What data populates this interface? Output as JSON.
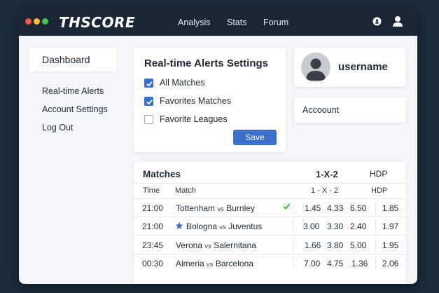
{
  "app": {
    "brand": "THSCORE"
  },
  "nav": {
    "analysis": "Analysis",
    "stats": "Stats",
    "forum": "Forum"
  },
  "topbar_icons": [
    "info-icon",
    "user-icon"
  ],
  "sidebar": {
    "items": [
      {
        "label": "Dashboard",
        "active": true
      },
      {
        "label": "Real-time Alerts"
      },
      {
        "label": "Account Settings"
      },
      {
        "label": "Log Out"
      }
    ]
  },
  "alerts": {
    "title": "Real-time Alerts Settings",
    "options": [
      {
        "label": "All Matches",
        "checked": true
      },
      {
        "label": "Favorites Matches",
        "checked": true
      },
      {
        "label": "Favorite Leagues",
        "checked": false
      }
    ],
    "save_label": "Save"
  },
  "profile": {
    "username": "username"
  },
  "account": {
    "label": "Accoount"
  },
  "matches": {
    "title": "Matches",
    "header_1x2": "1-X-2",
    "header_hdp": "HDP",
    "columns": {
      "time": "Time",
      "match": "Match",
      "odds": "1 - X - 2",
      "hdp": "HDP"
    },
    "rows": [
      {
        "time": "21:00",
        "home": "Tottenham",
        "vs": "vs",
        "away": "Burnley",
        "marker": "check",
        "o1": "1.45",
        "ox": "4.33",
        "o2": "6.50",
        "hdp": "1.85"
      },
      {
        "time": "21:00",
        "home": "Bologna",
        "vs": "vs",
        "away": "Juventus",
        "marker": "star",
        "o1": "3.00",
        "ox": "3.30",
        "o2": "2.40",
        "hdp": "1.97"
      },
      {
        "time": "23:45",
        "home": "Verona",
        "vs": "vs",
        "away": "Salernitana",
        "marker": "",
        "o1": "1.66",
        "ox": "3.80",
        "o2": "5.00",
        "hdp": "1.95"
      },
      {
        "time": "00:30",
        "home": "Almeria",
        "vs": "vs",
        "away": "Barcelona",
        "marker": "",
        "o1": "7.00",
        "ox": "4.75",
        "o2": "1.36",
        "hdp": "2.06"
      }
    ]
  },
  "colors": {
    "accent": "#3b6fc9",
    "topbar": "#1a2535",
    "check": "#3bb54a",
    "star": "#3b6fc9"
  }
}
